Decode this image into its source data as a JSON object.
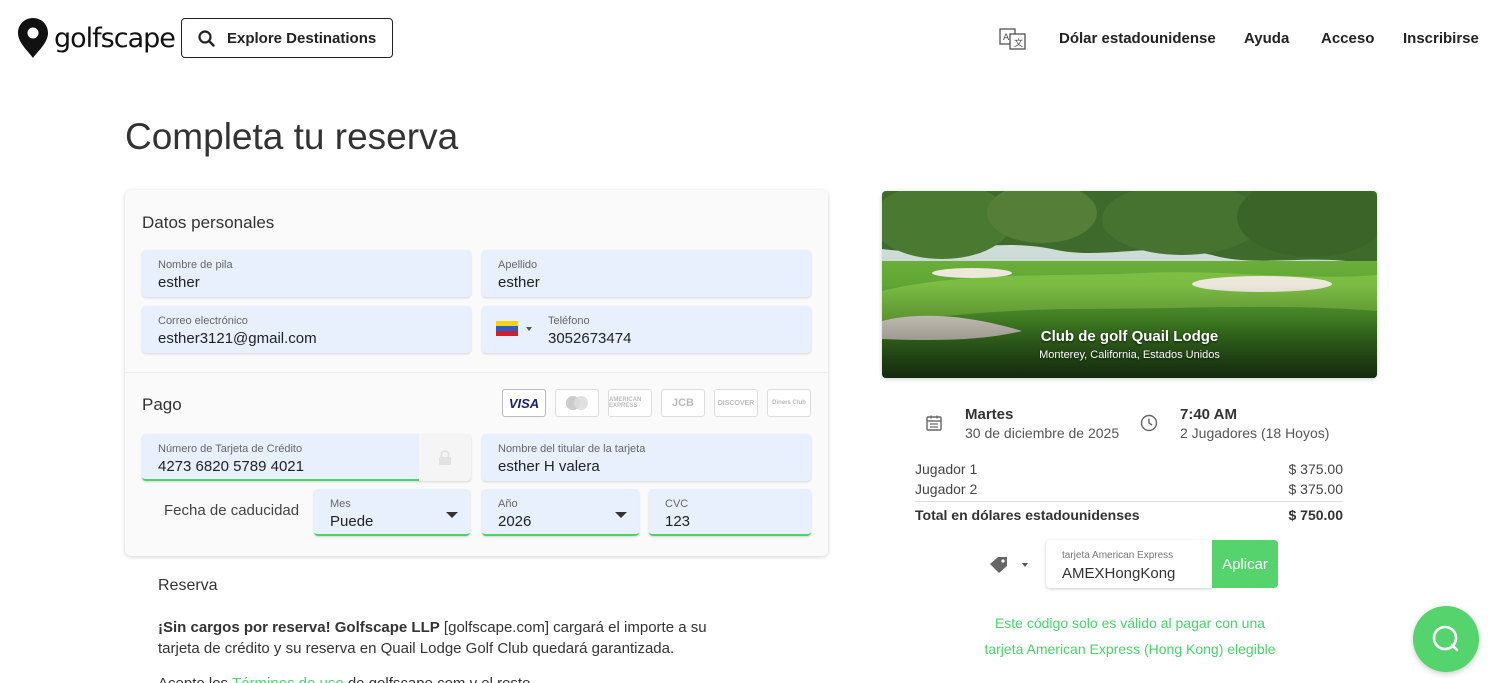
{
  "header": {
    "logo_text": "golfscape",
    "explore_label": "Explore Destinations",
    "currency_label": "Dólar estadounidense",
    "help_label": "Ayuda",
    "login_label": "Acceso",
    "signup_label": "Inscribirse"
  },
  "page": {
    "title": "Completa tu reserva"
  },
  "personal": {
    "section_title": "Datos personales",
    "first_name": {
      "label": "Nombre de pila",
      "value": "esther"
    },
    "last_name": {
      "label": "Apellido",
      "value": "esther"
    },
    "email": {
      "label": "Correo electrónico",
      "value": "esther3121@gmail.com"
    },
    "phone": {
      "label": "Teléfono",
      "value": "3052673474"
    }
  },
  "payment": {
    "section_title": "Pago",
    "card_brands": [
      "VISA",
      "mastercard",
      "AMERICAN EXPRESS",
      "JCB",
      "DISCOVER",
      "Diners Club"
    ],
    "card_number": {
      "label": "Número de Tarjeta de Crédito",
      "value": "4273 6820 5789 4021"
    },
    "card_holder": {
      "label": "Nombre del titular de la tarjeta",
      "value": "esther H valera"
    },
    "expiry_label": "Fecha de caducidad",
    "month": {
      "label": "Mes",
      "value": "Puede"
    },
    "year": {
      "label": "Año",
      "value": "2026"
    },
    "cvc": {
      "label": "CVC",
      "value": "123"
    }
  },
  "reserva": {
    "title": "Reserva",
    "bold_text": "¡Sin cargos por reserva! Golfscape LLP",
    "text": " [golfscape.com] cargará el importe a su tarjeta de crédito y su reserva en Quail Lodge Golf Club quedará garantizada.",
    "cut_prefix": "Acepto los ",
    "cut_link": "Términos de uso",
    "cut_suffix": " de golfscape.com y el resto"
  },
  "course": {
    "name": "Club de golf Quail Lodge",
    "location": "Monterey, California, Estados Unidos"
  },
  "booking": {
    "day": "Martes",
    "date": "30 de diciembre de 2025",
    "time": "7:40 AM",
    "players": "2 Jugadores (18 Hoyos)"
  },
  "pricing": {
    "rows": [
      {
        "label": "Jugador 1",
        "amount": "$ 375.00"
      },
      {
        "label": "Jugador 2",
        "amount": "$ 375.00"
      }
    ],
    "total_label": "Total en dólares estadounidenses",
    "total_amount": "$ 750.00"
  },
  "promo": {
    "label": "tarjeta American Express",
    "value": "AMEXHongKong",
    "apply_label": "Aplicar",
    "note_line1": "Este código solo es válido al pagar con una",
    "note_line2": "tarjeta American Express (Hong Kong) elegible"
  },
  "colors": {
    "accent": "#4ad26b",
    "field_bg": "#e8f0fe"
  }
}
